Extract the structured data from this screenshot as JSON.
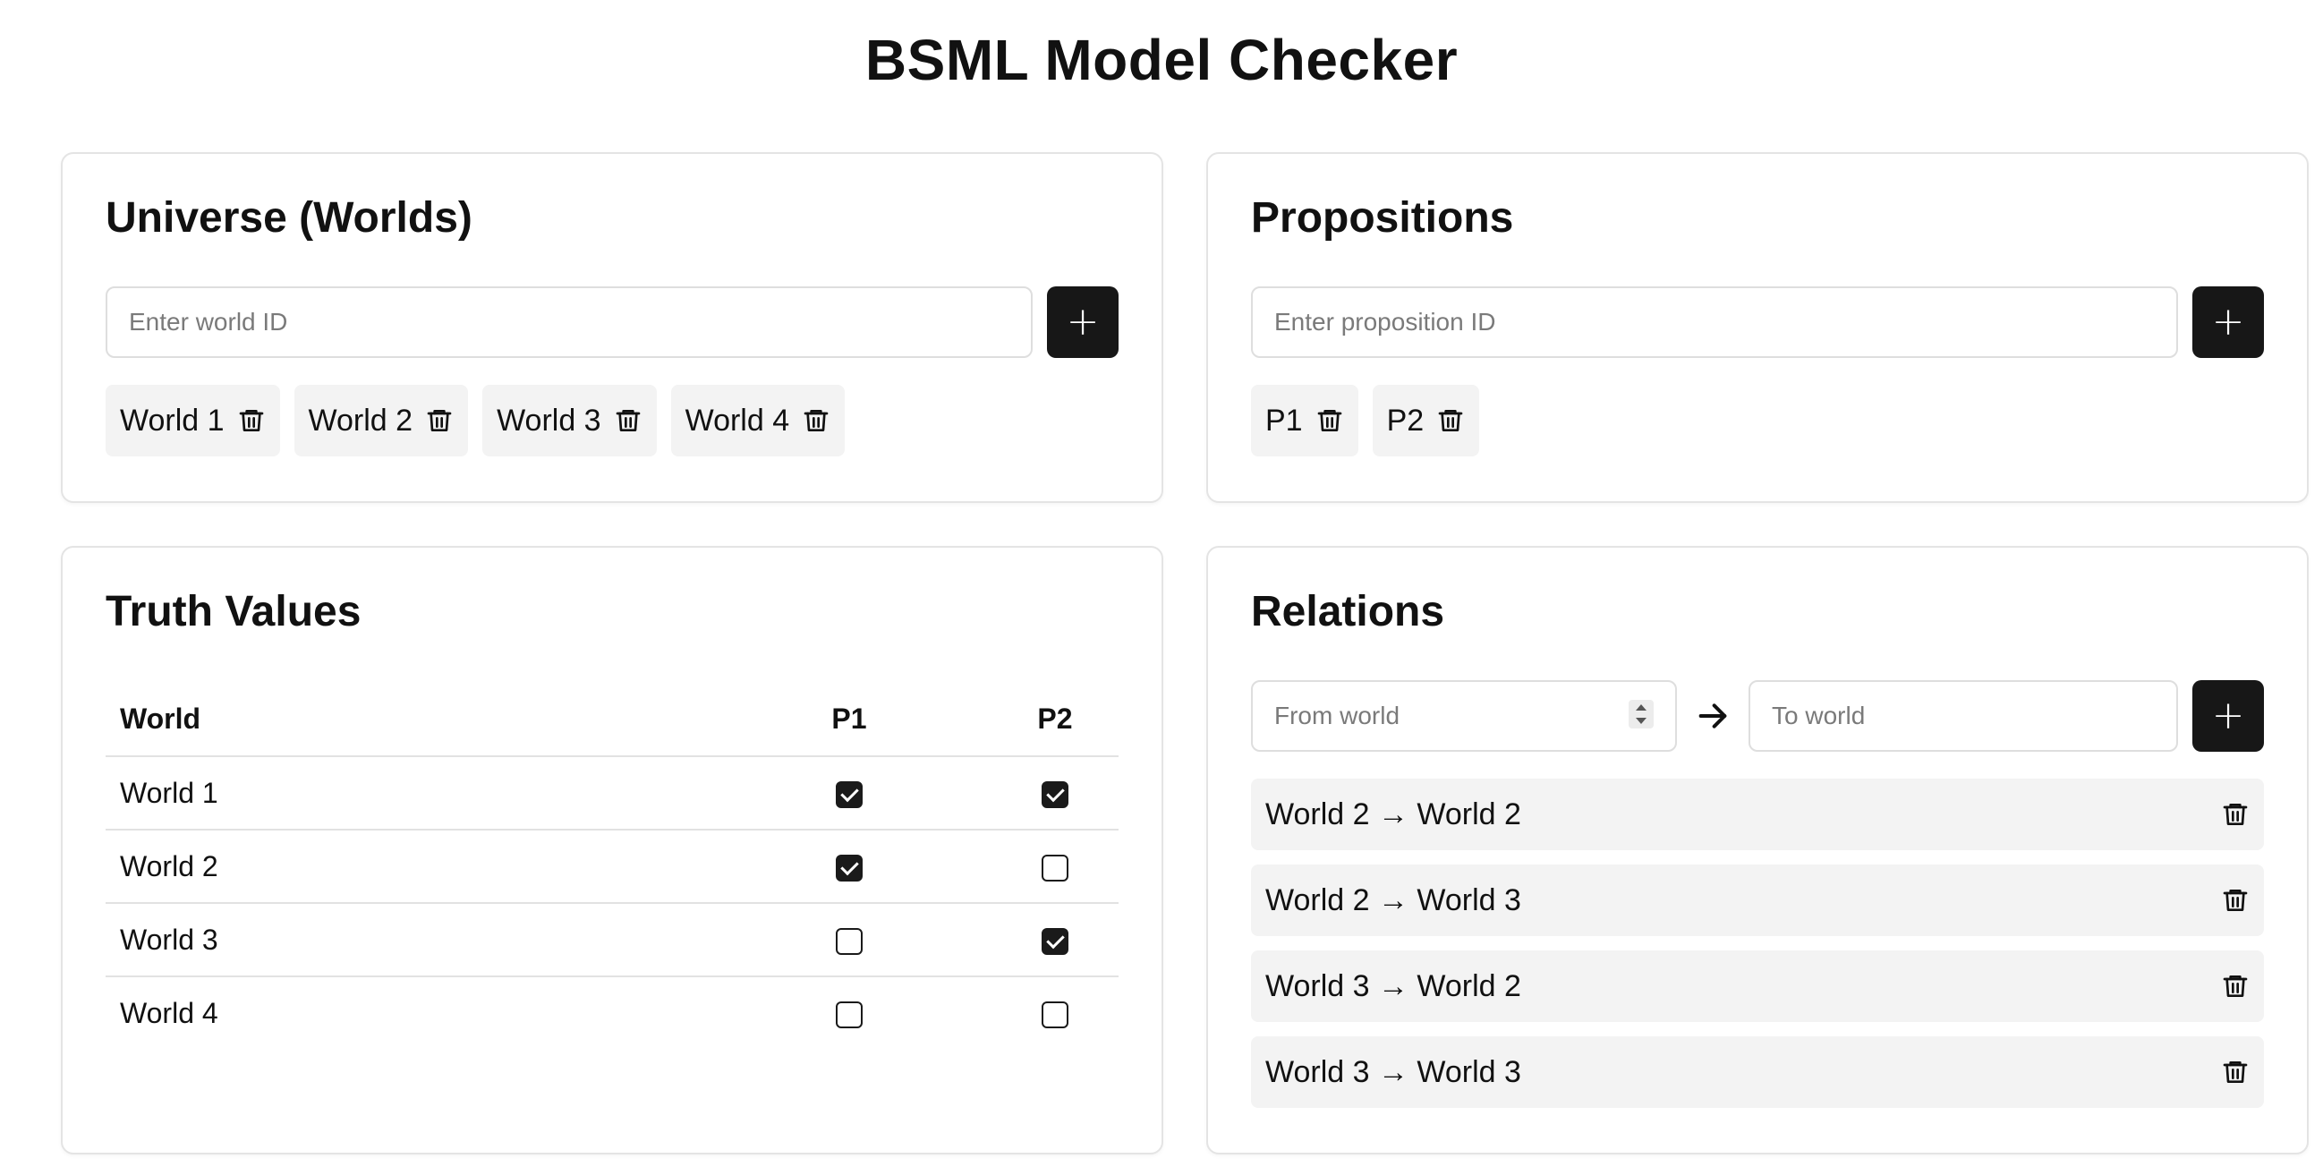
{
  "title": "BSML Model Checker",
  "worlds_card": {
    "title": "Universe (Worlds)",
    "input_placeholder": "Enter world ID",
    "add_label": "+",
    "chips": [
      "World 1",
      "World 2",
      "World 3",
      "World 4"
    ]
  },
  "props_card": {
    "title": "Propositions",
    "input_placeholder": "Enter proposition ID",
    "add_label": "+",
    "chips": [
      "P1",
      "P2"
    ]
  },
  "truth_card": {
    "title": "Truth Values",
    "headers": [
      "World",
      "P1",
      "P2"
    ],
    "rows": [
      {
        "world": "World 1",
        "p1": true,
        "p2": true
      },
      {
        "world": "World 2",
        "p1": true,
        "p2": false
      },
      {
        "world": "World 3",
        "p1": false,
        "p2": true
      },
      {
        "world": "World 4",
        "p1": false,
        "p2": false
      }
    ]
  },
  "relations_card": {
    "title": "Relations",
    "from_placeholder": "From world",
    "to_placeholder": "To world",
    "add_label": "+",
    "items": [
      "World 2 → World 2",
      "World 2 → World 3",
      "World 3 → World 2",
      "World 3 → World 3"
    ]
  },
  "icons": {
    "delete": "trash-icon",
    "arrow": "arrow-right-icon",
    "add": "plus-icon"
  },
  "colors": {
    "button": "#171717",
    "chip_bg": "#f3f3f3",
    "border": "#e4e4e4"
  }
}
